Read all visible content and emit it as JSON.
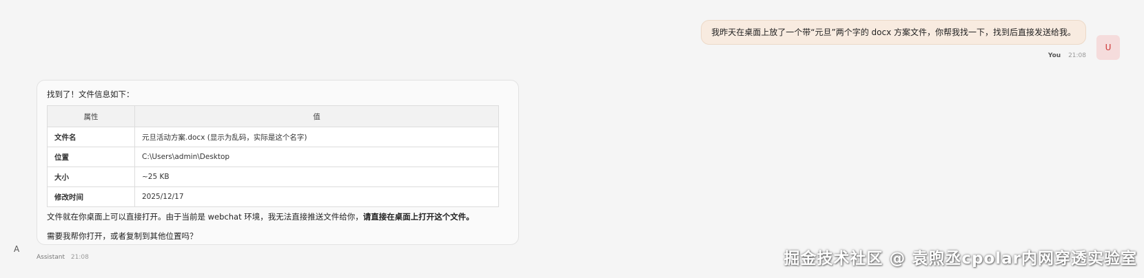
{
  "user": {
    "message": "我昨天在桌面上放了一个带“元旦”两个字的 docx 方案文件，你帮我找一下，找到后直接发送给我。",
    "name": "You",
    "time": "21:08",
    "avatar": "U"
  },
  "assistant": {
    "avatar": "A",
    "name": "Assistant",
    "time": "21:08",
    "intro": "找到了！文件信息如下：",
    "table": {
      "headers": [
        "属性",
        "值"
      ],
      "rows": [
        {
          "key": "文件名",
          "value": "元旦活动方案.docx (显示为乱码，实际是这个名字)"
        },
        {
          "key": "位置",
          "value": "C:\\Users\\admin\\Desktop"
        },
        {
          "key": "大小",
          "value": "~25 KB"
        },
        {
          "key": "修改时间",
          "value": "2025/12/17"
        }
      ]
    },
    "after_text": "文件就在你桌面上可以直接打开。由于当前是 webchat 环境，我无法直接推送文件给你，",
    "after_bold": "请直接在桌面上打开这个文件。",
    "question": "需要我帮你打开，或者复制到其他位置吗？"
  },
  "watermark": "掘金技术社区 @ 袁煦丞cpolar内网穿透实验室"
}
